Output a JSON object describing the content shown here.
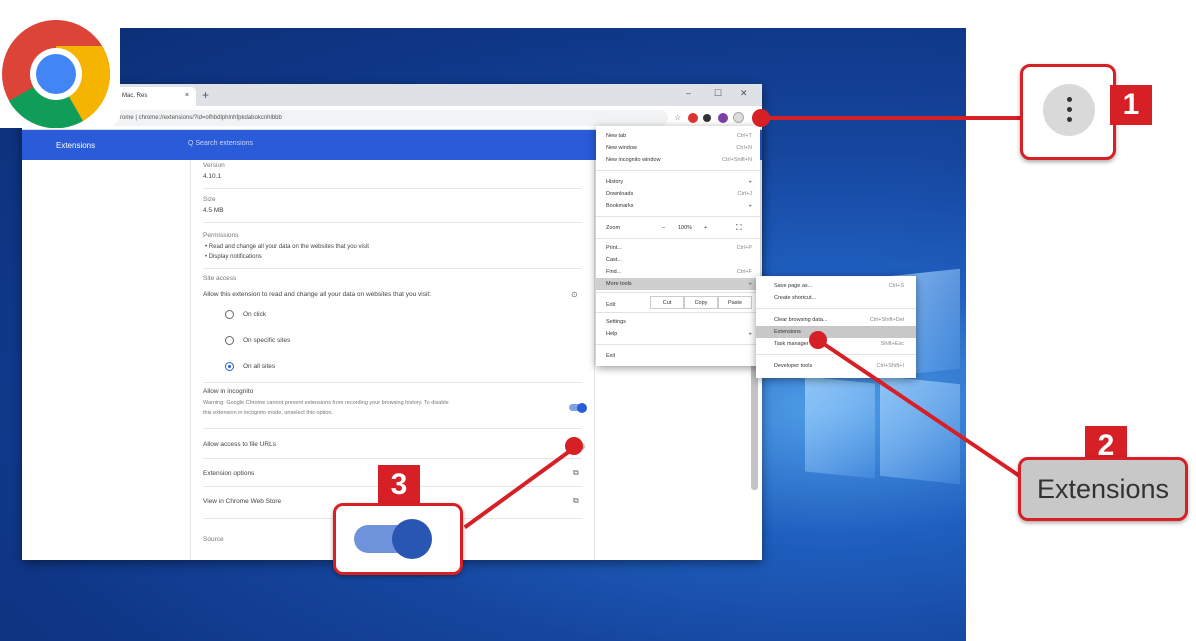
{
  "browser": {
    "tab_title": "Mac. Res",
    "tab_close": "×",
    "new_tab": "+",
    "win_min": "–",
    "win_max": "☐",
    "win_close": "✕",
    "url": "rome | chrome://extensions/?id=ofhbdlphlnhfpkdabokcnhlbbb",
    "ext_title": "Extensions",
    "search_placeholder": "Q   Search extensions"
  },
  "details": {
    "version_label": "Version",
    "version_value": "4.10.1",
    "size_label": "Size",
    "size_value": "4.5 MB",
    "permissions_label": "Permissions",
    "perm_1": "•  Read and change all your data on the websites that you visit",
    "perm_2": "•  Display notifications",
    "site_access_label": "Site access",
    "site_access_desc": "Allow this extension to read and change all your data on websites that you visit:",
    "opt_click": "On click",
    "opt_specific": "On specific sites",
    "opt_all": "On all sites",
    "incognito_label": "Allow in incognito",
    "incognito_warning_1": "Warning: Google Chrome cannot prevent extensions from recording your browsing history. To disable",
    "incognito_warning_2": "this extension in incognito mode, unselect this option.",
    "file_urls": "Allow access to file URLs",
    "ext_options": "Extension options",
    "view_store": "View in Chrome Web Store",
    "source": "Source"
  },
  "menu": {
    "new_tab": "New tab",
    "new_tab_sc": "Ctrl+T",
    "new_window": "New window",
    "new_window_sc": "Ctrl+N",
    "new_incognito": "New incognito window",
    "new_incognito_sc": "Ctrl+Shift+N",
    "history": "History",
    "downloads": "Downloads",
    "downloads_sc": "Ctrl+J",
    "bookmarks": "Bookmarks",
    "zoom": "Zoom",
    "zoom_minus": "–",
    "zoom_value": "100%",
    "zoom_plus": "+",
    "print": "Print...",
    "print_sc": "Ctrl+P",
    "cast": "Cast...",
    "find": "Find...",
    "find_sc": "Ctrl+F",
    "more_tools": "More tools",
    "edit": "Edit",
    "cut": "Cut",
    "copy": "Copy",
    "paste": "Paste",
    "settings": "Settings",
    "help": "Help",
    "exit": "Exit"
  },
  "submenu": {
    "save_page": "Save page as...",
    "save_page_sc": "Ctrl+S",
    "create_shortcut": "Create shortcut...",
    "clear_browsing": "Clear browsing data...",
    "clear_browsing_sc": "Ctrl+Shift+Del",
    "extensions": "Extensions",
    "task_manager": "Task manager",
    "task_manager_sc": "Shift+Esc",
    "dev_tools": "Developer tools",
    "dev_tools_sc": "Ctrl+Shift+I"
  },
  "callouts": {
    "step1": "1",
    "step2": "2",
    "step2_label": "Extensions",
    "step3": "3"
  },
  "colors": {
    "accent_red": "#d71f26",
    "chrome_blue": "#2a5bd8"
  },
  "icons": [
    "chrome-logo-icon",
    "star-icon",
    "three-dots-icon",
    "external-link-icon",
    "help-icon",
    "search-icon"
  ]
}
